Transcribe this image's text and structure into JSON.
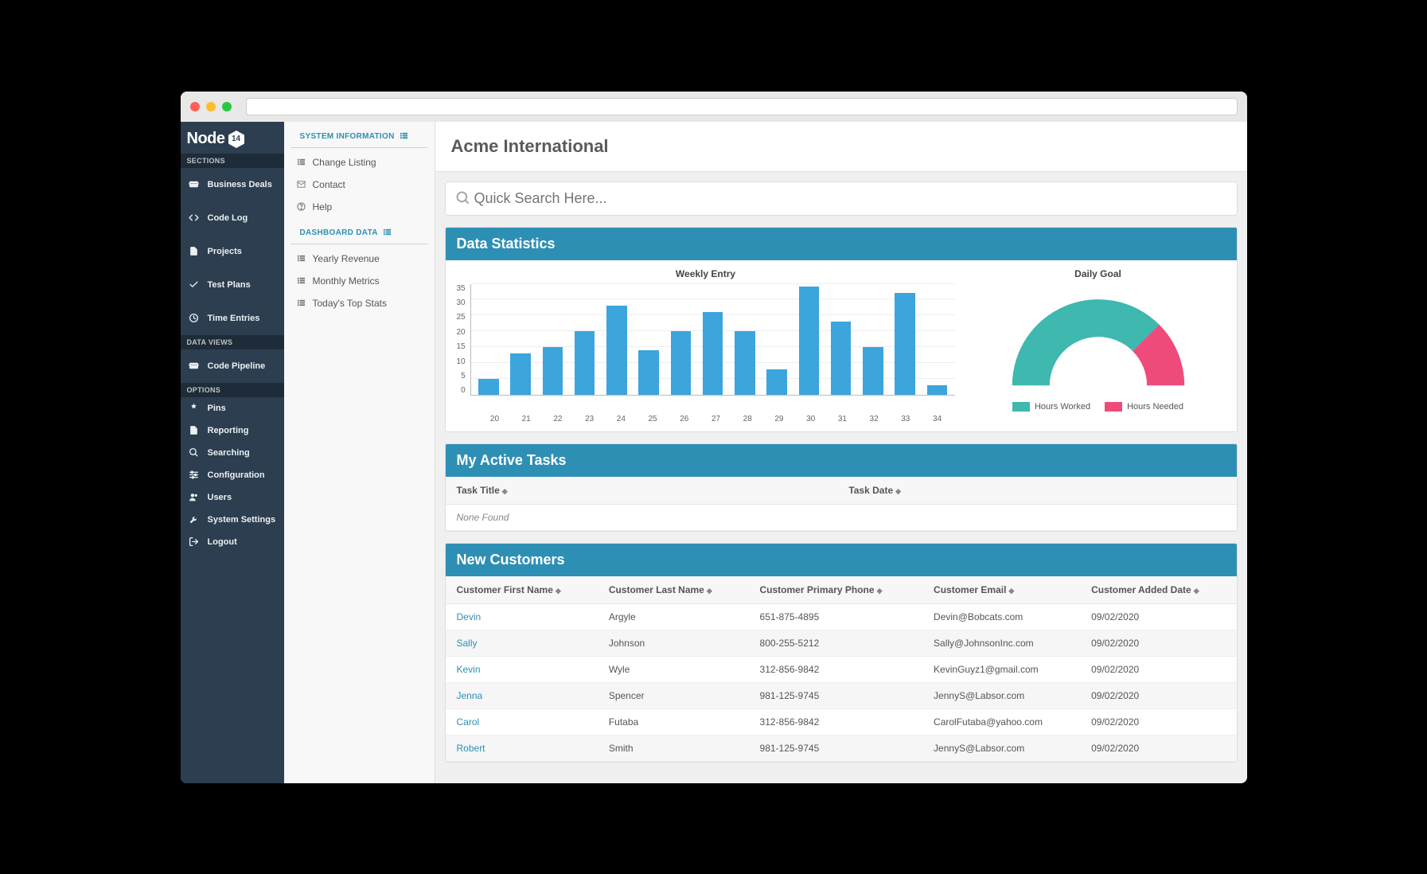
{
  "brand": {
    "name": "Node",
    "badge": "14"
  },
  "sidebar": {
    "groups": [
      {
        "header": "SECTIONS",
        "compact": false,
        "items": [
          {
            "icon": "card-icon",
            "label": "Business Deals",
            "name": "nav-business-deals"
          },
          {
            "icon": "code-icon",
            "label": "Code Log",
            "name": "nav-code-log"
          },
          {
            "icon": "file-icon",
            "label": "Projects",
            "name": "nav-projects"
          },
          {
            "icon": "check-icon",
            "label": "Test Plans",
            "name": "nav-test-plans"
          },
          {
            "icon": "clock-icon",
            "label": "Time Entries",
            "name": "nav-time-entries"
          }
        ]
      },
      {
        "header": "DATA VIEWS",
        "compact": false,
        "items": [
          {
            "icon": "card-icon",
            "label": "Code Pipeline",
            "name": "nav-code-pipeline"
          }
        ]
      },
      {
        "header": "OPTIONS",
        "compact": true,
        "items": [
          {
            "icon": "pin-icon",
            "label": "Pins",
            "name": "nav-pins"
          },
          {
            "icon": "doc-icon",
            "label": "Reporting",
            "name": "nav-reporting"
          },
          {
            "icon": "search-icon",
            "label": "Searching",
            "name": "nav-searching"
          },
          {
            "icon": "sliders-icon",
            "label": "Configuration",
            "name": "nav-configuration"
          },
          {
            "icon": "users-icon",
            "label": "Users",
            "name": "nav-users"
          },
          {
            "icon": "wrench-icon",
            "label": "System Settings",
            "name": "nav-system-settings"
          },
          {
            "icon": "logout-icon",
            "label": "Logout",
            "name": "nav-logout"
          }
        ]
      }
    ]
  },
  "subSidebar": {
    "groups": [
      {
        "title": "SYSTEM INFORMATION",
        "items": [
          {
            "icon": "list-icon",
            "label": "Change Listing",
            "name": "sub-change-listing"
          },
          {
            "icon": "mail-icon",
            "label": "Contact",
            "name": "sub-contact"
          },
          {
            "icon": "help-icon",
            "label": "Help",
            "name": "sub-help"
          }
        ]
      },
      {
        "title": "DASHBOARD DATA",
        "items": [
          {
            "icon": "list-icon",
            "label": "Yearly Revenue",
            "name": "sub-yearly-revenue"
          },
          {
            "icon": "list-icon",
            "label": "Monthly Metrics",
            "name": "sub-monthly-metrics"
          },
          {
            "icon": "list-icon",
            "label": "Today's Top Stats",
            "name": "sub-todays-top-stats"
          }
        ]
      }
    ]
  },
  "page": {
    "title": "Acme International",
    "searchPlaceholder": "Quick Search Here..."
  },
  "panels": {
    "stats": {
      "title": "Data Statistics"
    },
    "tasks": {
      "title": "My Active Tasks",
      "cols": [
        "Task Title",
        "Task Date"
      ],
      "empty": "None Found"
    },
    "customers": {
      "title": "New Customers",
      "cols": [
        "Customer First Name",
        "Customer Last Name",
        "Customer Primary Phone",
        "Customer Email",
        "Customer Added Date"
      ],
      "rows": [
        {
          "first": "Devin",
          "last": "Argyle",
          "phone": "651-875-4895",
          "email": "Devin@Bobcats.com",
          "added": "09/02/2020"
        },
        {
          "first": "Sally",
          "last": "Johnson",
          "phone": "800-255-5212",
          "email": "Sally@JohnsonInc.com",
          "added": "09/02/2020"
        },
        {
          "first": "Kevin",
          "last": "Wyle",
          "phone": "312-856-9842",
          "email": "KevinGuyz1@gmail.com",
          "added": "09/02/2020"
        },
        {
          "first": "Jenna",
          "last": "Spencer",
          "phone": "981-125-9745",
          "email": "JennyS@Labsor.com",
          "added": "09/02/2020"
        },
        {
          "first": "Carol",
          "last": "Futaba",
          "phone": "312-856-9842",
          "email": "CarolFutaba@yahoo.com",
          "added": "09/02/2020"
        },
        {
          "first": "Robert",
          "last": "Smith",
          "phone": "981-125-9745",
          "email": "JennyS@Labsor.com",
          "added": "09/02/2020"
        }
      ]
    }
  },
  "chart_data": [
    {
      "type": "bar",
      "title": "Weekly Entry",
      "categories": [
        "20",
        "21",
        "22",
        "23",
        "24",
        "25",
        "26",
        "27",
        "28",
        "29",
        "30",
        "31",
        "32",
        "33",
        "34"
      ],
      "values": [
        5,
        13,
        15,
        20,
        28,
        14,
        20,
        26,
        20,
        8,
        34,
        23,
        15,
        32,
        3
      ],
      "ylabel": "",
      "xlabel": "",
      "ylim": [
        0,
        35
      ],
      "yticks": [
        0,
        5,
        10,
        15,
        20,
        25,
        30,
        35
      ],
      "bar_color": "#3ca5dd"
    },
    {
      "type": "gauge",
      "title": "Daily Goal",
      "series": [
        {
          "name": "Hours Worked",
          "value": 75,
          "color": "#3fb8af"
        },
        {
          "name": "Hours Needed",
          "value": 25,
          "color": "#ee4b7b"
        }
      ],
      "range": [
        0,
        100
      ]
    }
  ],
  "icons": {
    "card-icon": "▤",
    "code-icon": "</>",
    "file-icon": "■",
    "check-icon": "✓",
    "clock-icon": "◴",
    "pin-icon": "▼",
    "doc-icon": "■",
    "search-icon": "○",
    "sliders-icon": "≡",
    "users-icon": "●",
    "wrench-icon": "⚒",
    "logout-icon": "↪",
    "list-icon": "☰",
    "mail-icon": "✉",
    "help-icon": "?"
  }
}
